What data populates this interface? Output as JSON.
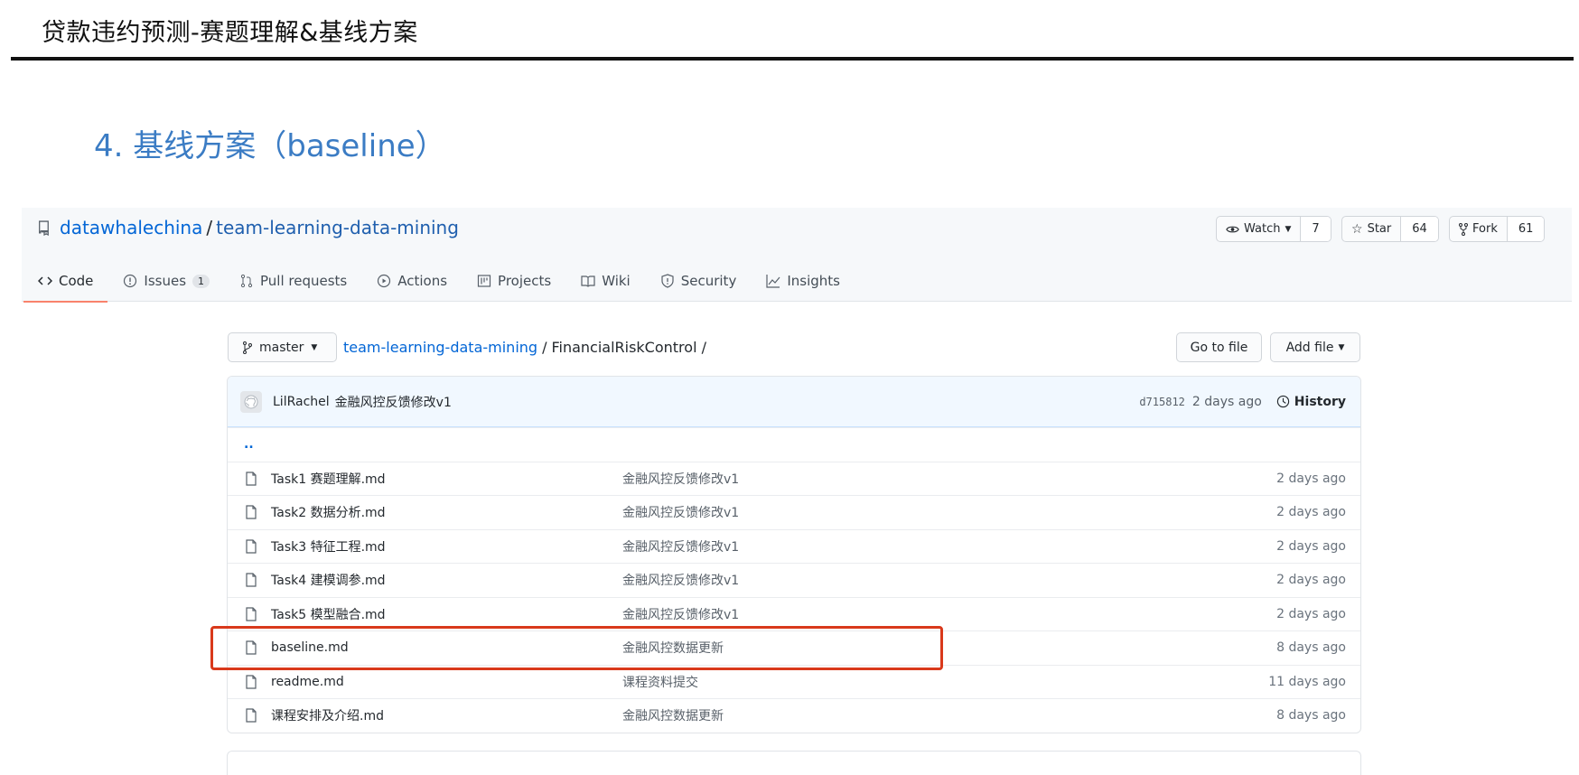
{
  "slide": {
    "title": "贷款违约预测-赛题理解&基线方案",
    "section_heading": "4. 基线方案（baseline）"
  },
  "repo": {
    "owner": "datawhalechina",
    "separator": "/",
    "name": "team-learning-data-mining",
    "watch": {
      "label": "Watch",
      "count": "7"
    },
    "star": {
      "label": "Star",
      "count": "64"
    },
    "fork": {
      "label": "Fork",
      "count": "61"
    }
  },
  "tabs": [
    {
      "label": "Code",
      "icon": "code-icon"
    },
    {
      "label": "Issues",
      "count": "1",
      "icon": "issue-icon"
    },
    {
      "label": "Pull requests",
      "icon": "pull-request-icon"
    },
    {
      "label": "Actions",
      "icon": "play-icon"
    },
    {
      "label": "Projects",
      "icon": "project-icon"
    },
    {
      "label": "Wiki",
      "icon": "book-icon"
    },
    {
      "label": "Security",
      "icon": "shield-icon"
    },
    {
      "label": "Insights",
      "icon": "graph-icon"
    }
  ],
  "toolbar": {
    "branch": "master",
    "breadcrumb_repo": "team-learning-data-mining",
    "breadcrumb_sep": "/",
    "breadcrumb_dir": "FinancialRiskControl /",
    "goto_file": "Go to file",
    "add_file": "Add file"
  },
  "commit": {
    "author": "LilRachel",
    "message": "金融风控反馈修改v1",
    "sha": "d715812",
    "age": "2 days ago",
    "history": "History"
  },
  "parent_dir": "..",
  "files": [
    {
      "name": "Task1 赛题理解.md",
      "message": "金融风控反馈修改v1",
      "age": "2 days ago"
    },
    {
      "name": "Task2 数据分析.md",
      "message": "金融风控反馈修改v1",
      "age": "2 days ago"
    },
    {
      "name": "Task3 特征工程.md",
      "message": "金融风控反馈修改v1",
      "age": "2 days ago"
    },
    {
      "name": "Task4 建模调参.md",
      "message": "金融风控反馈修改v1",
      "age": "2 days ago"
    },
    {
      "name": "Task5 模型融合.md",
      "message": "金融风控反馈修改v1",
      "age": "2 days ago"
    },
    {
      "name": "baseline.md",
      "message": "金融风控数据更新",
      "age": "8 days ago"
    },
    {
      "name": "readme.md",
      "message": "课程资料提交",
      "age": "11 days ago"
    },
    {
      "name": "课程安排及介绍.md",
      "message": "金融风控数据更新",
      "age": "8 days ago"
    }
  ],
  "colors": {
    "highlight": "#d9391b",
    "link": "#0366d6",
    "heading": "#3b7cc4"
  }
}
